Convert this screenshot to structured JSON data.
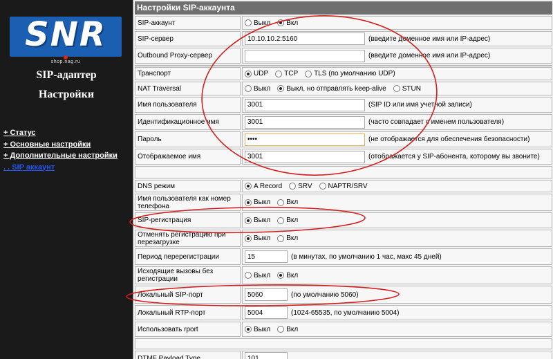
{
  "logo": {
    "text": "SNR",
    "url": "shop.nag.ru"
  },
  "sidebar": {
    "title1": "SIP-адаптер",
    "title2": "Настройки",
    "items": [
      {
        "label": "+ Статус"
      },
      {
        "label": "+ Основные настройки"
      },
      {
        "label": "+ Дополнительные настройки"
      },
      {
        "label": ". . SIP аккаунт"
      }
    ]
  },
  "section": {
    "title": "Настройки SIP-аккаунта"
  },
  "fields": {
    "sip_account": {
      "label": "SIP-аккаунт",
      "options": [
        "Выкл",
        "Вкл"
      ],
      "selected": 1
    },
    "sip_server": {
      "label": "SIP-сервер",
      "value": "10.10.10.2:5160",
      "hint": "(введите доменное имя или IP-адрес)"
    },
    "outbound_proxy": {
      "label": "Outbound Proxy-сервер",
      "value": "",
      "hint": "(введите доменное имя или IP-адрес)"
    },
    "transport": {
      "label": "Транспорт",
      "options": [
        "UDP",
        "TCP",
        "TLS (по умолчанию UDP)"
      ],
      "selected": 0
    },
    "nat_traversal": {
      "label": "NAT Traversal",
      "options": [
        "Выкл",
        "Выкл, но отправлять keep-alive",
        "STUN"
      ],
      "selected": 1
    },
    "username": {
      "label": "Имя пользователя",
      "value": "3001",
      "hint": "(SIP ID или имя учетной записи)"
    },
    "auth_id": {
      "label": "Идентификационное имя",
      "value": "3001",
      "hint": "(часто совпадает с именем пользователя)"
    },
    "password": {
      "label": "Пароль",
      "value": "••••",
      "hint": "(не отображается для обеспечения безопасности)"
    },
    "display_name": {
      "label": "Отображаемое имя",
      "value": "3001",
      "hint": "(отображается у SIP-абонента, которому вы звоните)"
    },
    "dns_mode": {
      "label": "DNS режим",
      "options": [
        "A Record",
        "SRV",
        "NAPTR/SRV"
      ],
      "selected": 0
    },
    "username_as_number": {
      "label": "Имя пользователя как номер телефона",
      "options": [
        "Выкл",
        "Вкл"
      ],
      "selected": 0
    },
    "sip_registration": {
      "label": "SIP-регистрация",
      "options": [
        "Выкл",
        "Вкл"
      ],
      "selected": 0
    },
    "unregister_on_reboot": {
      "label": "Отменять регистрацию при перезагрузке",
      "options": [
        "Выкл",
        "Вкл"
      ],
      "selected": 0
    },
    "reregister_period": {
      "label": "Период перерегистрации",
      "value": "15",
      "hint": "(в минутах, по умолчанию 1 час, макс 45 дней)"
    },
    "outgoing_without_reg": {
      "label": "Исходящие вызовы без регистрации",
      "options": [
        "Выкл",
        "Вкл"
      ],
      "selected": 1
    },
    "local_sip_port": {
      "label": "Локальный SIP-порт",
      "value": "5060",
      "hint": "(по умолчанию 5060)"
    },
    "local_rtp_port": {
      "label": "Локальный RTP-порт",
      "value": "5004",
      "hint": "(1024-65535, по умолчанию 5004)"
    },
    "use_rport": {
      "label": "Использовать rport",
      "options": [
        "Выкл",
        "Вкл"
      ],
      "selected": 0
    },
    "dtmf_payload": {
      "label": "DTMF Payload Type",
      "value": "101"
    }
  },
  "colors": {
    "annotation": "#d42020",
    "link_active": "#1f56ff",
    "header_bg": "#6f6f6f"
  }
}
